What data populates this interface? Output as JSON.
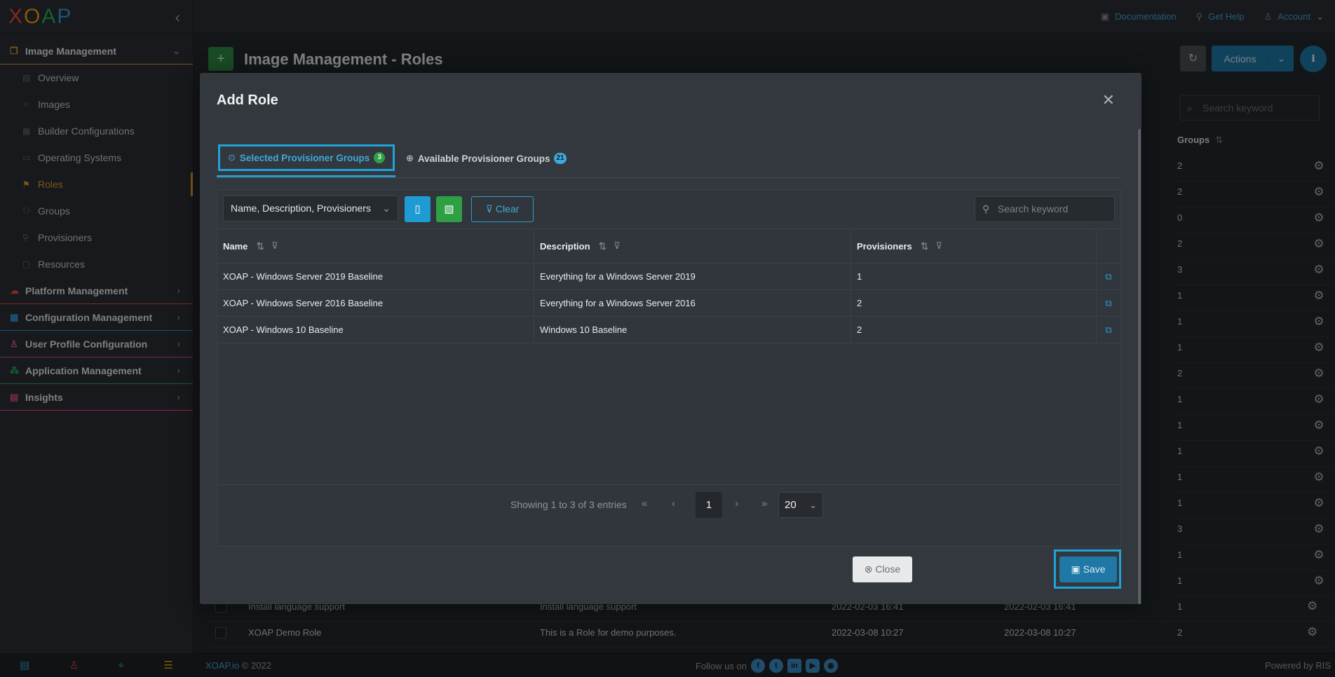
{
  "logo": [
    "X",
    "O",
    "A",
    "P"
  ],
  "sidebar": {
    "sections": [
      {
        "label": "Image Management",
        "color": "#e0a030"
      },
      {
        "label": "Platform Management",
        "color": "#e74c3c"
      },
      {
        "label": "Configuration Management",
        "color": "#3498db"
      },
      {
        "label": "User Profile Configuration",
        "color": "#e056a0"
      },
      {
        "label": "Application Management",
        "color": "#27ae60"
      },
      {
        "label": "Insights",
        "color": "#e74c8c"
      }
    ],
    "image_items": [
      "Overview",
      "Images",
      "Builder Configurations",
      "Operating Systems",
      "Roles",
      "Groups",
      "Provisioners",
      "Resources"
    ],
    "active_item": "Roles"
  },
  "topbar": {
    "documentation": "Documentation",
    "help": "Get Help",
    "account": "Account"
  },
  "page": {
    "title": "Image Management - Roles",
    "add_label": "+",
    "actions_label": "Actions",
    "info_label": "i"
  },
  "background": {
    "search_placeholder": "Search keyword",
    "groups_header": "Groups",
    "group_counts": [
      "2",
      "2",
      "0",
      "2",
      "3",
      "1",
      "1",
      "1",
      "2",
      "1",
      "1",
      "1",
      "1",
      "1",
      "3",
      "1",
      "1"
    ],
    "rows": [
      {
        "name": "Install language support",
        "description": "Install language support",
        "created": "2022-02-03 16:41",
        "modified": "2022-02-03 16:41",
        "groups": "1"
      },
      {
        "name": "XOAP Demo Role",
        "description": "This is a Role for demo purposes.",
        "created": "2022-03-08 10:27",
        "modified": "2022-03-08 10:27",
        "groups": "2"
      }
    ]
  },
  "footer": {
    "brand": "XOAP.io",
    "copyright": "© 2022",
    "follow": "Follow us on",
    "powered": "Powered by RIS"
  },
  "modal": {
    "title": "Add Role",
    "tabs": [
      {
        "label": "Selected Provisioner Groups",
        "badge": "3"
      },
      {
        "label": "Available Provisioner Groups",
        "badge": "21"
      }
    ],
    "column_select": "Name, Description, Provisioners",
    "clear_label": "Clear",
    "search_placeholder": "Search keyword",
    "columns": [
      "Name",
      "Description",
      "Provisioners"
    ],
    "rows": [
      {
        "name": "XOAP - Windows Server 2019 Baseline",
        "description": "Everything for a Windows Server 2019",
        "provisioners": "1"
      },
      {
        "name": "XOAP - Windows Server 2016 Baseline",
        "description": "Everything for a Windows Server 2016",
        "provisioners": "2"
      },
      {
        "name": "XOAP - Windows 10 Baseline",
        "description": "Windows 10 Baseline",
        "provisioners": "2"
      }
    ],
    "pager_info": "Showing 1 to 3 of 3 entries",
    "current_page": "1",
    "page_size": "20",
    "close_label": "Close",
    "save_label": "Save"
  }
}
